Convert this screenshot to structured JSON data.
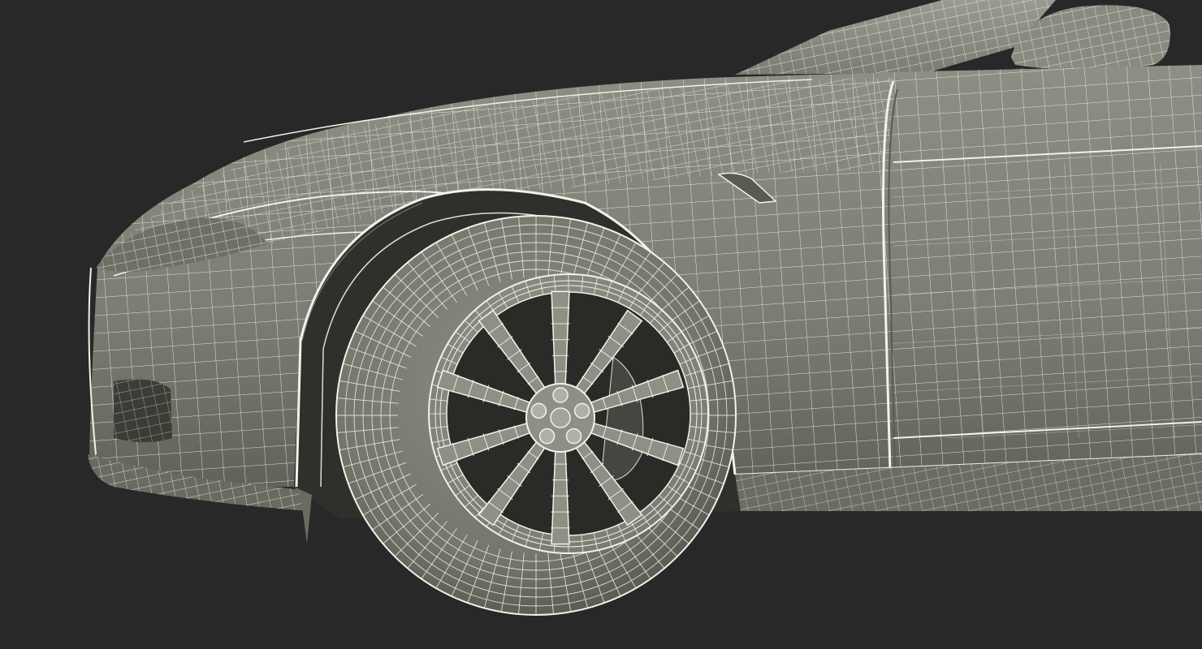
{
  "scene": {
    "subject": "car-front-wireframe-render",
    "colors": {
      "background": "#282828",
      "body_shade_light": "#8c8c82",
      "body_shade_mid": "#7b7b71",
      "body_shade_dark": "#4e4e47",
      "wheel_well": "#2e2e2b",
      "tire": "#7a7a70",
      "rim": "#8e8e84",
      "wire": "#f2f2ea"
    },
    "wheel": {
      "spoke_count": 10,
      "lug_nut_count": 5
    }
  }
}
